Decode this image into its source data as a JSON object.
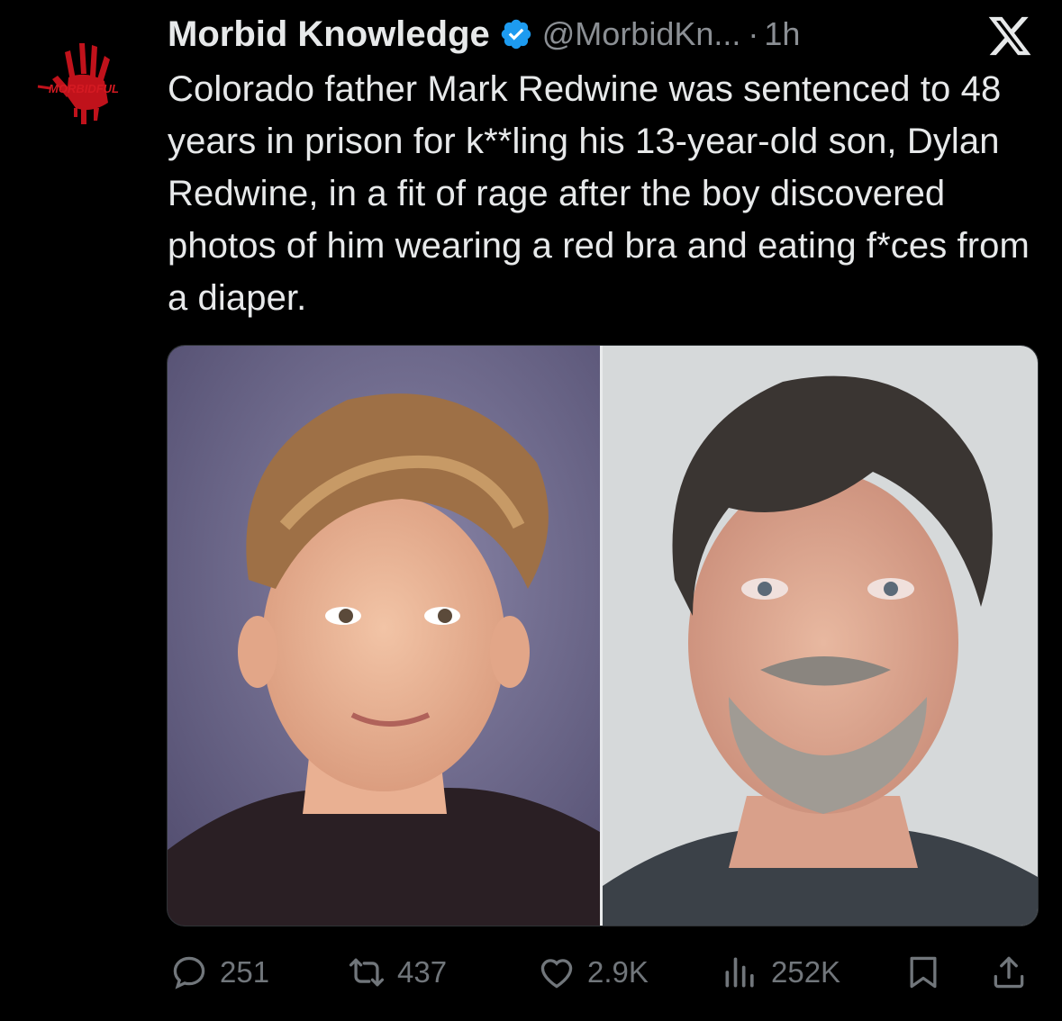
{
  "tweet": {
    "author_name": "Morbid Knowledge",
    "author_handle": "@MorbidKn...",
    "separator": "·",
    "time": "1h",
    "avatar_text": "MORBIDFUL",
    "text": "Colorado father Mark Redwine was sentenced to 48 years in prison for k**ling his 13-year-old son, Dylan Redwine, in a fit of rage after the boy discovered photos of him wearing a red bra and eating f*ces from a diaper."
  },
  "icons": {
    "verified": "verified-badge-icon",
    "brand": "x-logo-icon",
    "reply": "reply-icon",
    "retweet": "retweet-icon",
    "like": "heart-icon",
    "views": "views-chart-icon",
    "bookmark": "bookmark-icon",
    "share": "share-icon"
  },
  "stats": {
    "replies": "251",
    "retweets": "437",
    "likes": "2.9K",
    "views": "252K"
  },
  "colors": {
    "background": "#000000",
    "text": "#e7e9ea",
    "muted": "#71767b",
    "verified": "#1d9bf0",
    "avatar_accent": "#c0121b"
  }
}
